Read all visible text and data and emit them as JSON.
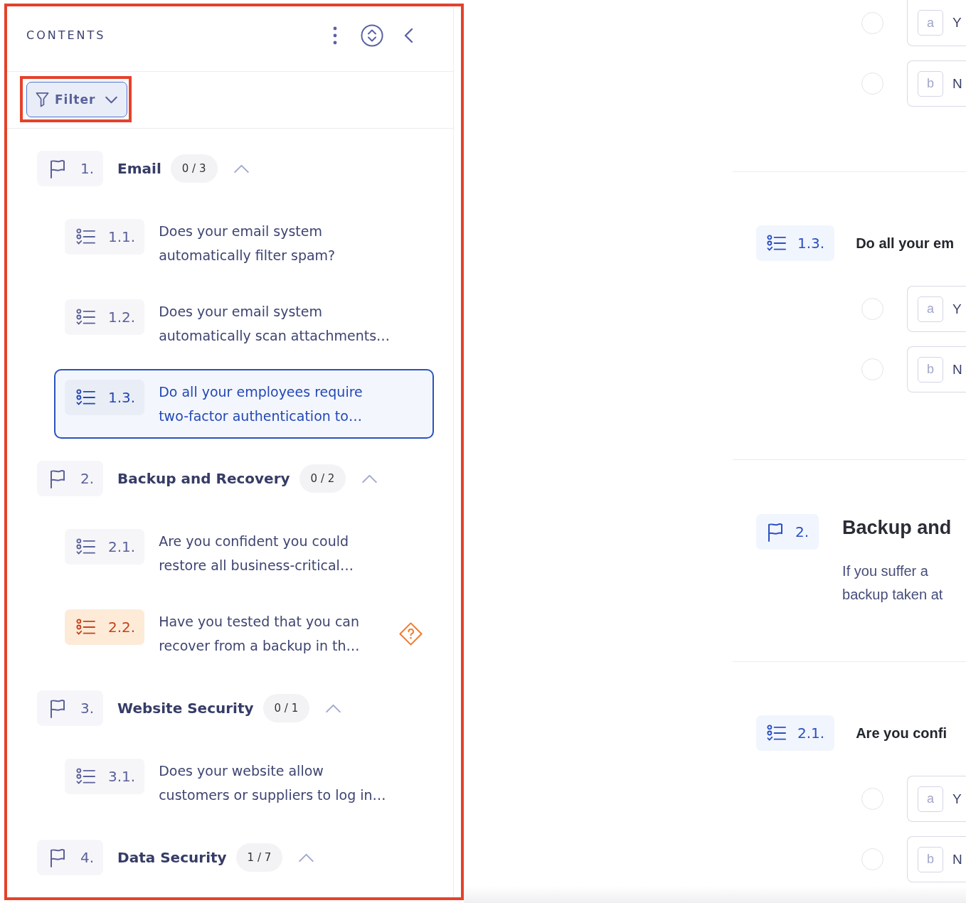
{
  "sidebar": {
    "highlighted": true,
    "title": "CONTENTS",
    "filter": {
      "label": "Filter",
      "highlighted": true
    },
    "sections": [
      {
        "number": "1.",
        "title": "Email",
        "progress": "0 / 3",
        "expanded": true,
        "children": [
          {
            "number": "1.1.",
            "text": "Does your email system\nautomatically filter spam?",
            "selected": false,
            "flagged": false
          },
          {
            "number": "1.2.",
            "text": "Does your email system\nautomatically scan attachments…",
            "selected": false,
            "flagged": false
          },
          {
            "number": "1.3.",
            "text": "Do all your employees require\ntwo-factor authentication to…",
            "selected": true,
            "flagged": false
          }
        ]
      },
      {
        "number": "2.",
        "title": "Backup and Recovery",
        "progress": "0 / 2",
        "expanded": true,
        "children": [
          {
            "number": "2.1.",
            "text": "Are you confident you could\nrestore all business-critical…",
            "selected": false,
            "flagged": false
          },
          {
            "number": "2.2.",
            "text": "Have you tested that you can\nrecover from a backup in th…",
            "selected": false,
            "flagged": true
          }
        ]
      },
      {
        "number": "3.",
        "title": "Website Security",
        "progress": "0 / 1",
        "expanded": true,
        "children": [
          {
            "number": "3.1.",
            "text": "Does your website allow\ncustomers or suppliers to log in…",
            "selected": false,
            "flagged": false
          }
        ]
      },
      {
        "number": "4.",
        "title": "Data Security",
        "progress": "1 / 7",
        "expanded": true
      }
    ]
  },
  "content": {
    "blocks": [
      {
        "kind": "question",
        "options": [
          {
            "letter": "a",
            "text": "Y",
            "selected": false
          },
          {
            "letter": "b",
            "text": "N",
            "selected": false
          }
        ]
      },
      {
        "kind": "question",
        "number": "1.3.",
        "text": "Do all your em",
        "options": [
          {
            "letter": "a",
            "text": "Y",
            "selected": false
          },
          {
            "letter": "b",
            "text": "N",
            "selected": false
          }
        ]
      },
      {
        "kind": "section",
        "number": "2.",
        "title": "Backup and",
        "description": "If you suffer a\nbackup taken at"
      },
      {
        "kind": "question",
        "number": "2.1.",
        "text": "Are you confi",
        "options": [
          {
            "letter": "a",
            "text": "Y",
            "selected": false
          },
          {
            "letter": "b",
            "text": "N",
            "selected": false
          }
        ]
      }
    ]
  }
}
